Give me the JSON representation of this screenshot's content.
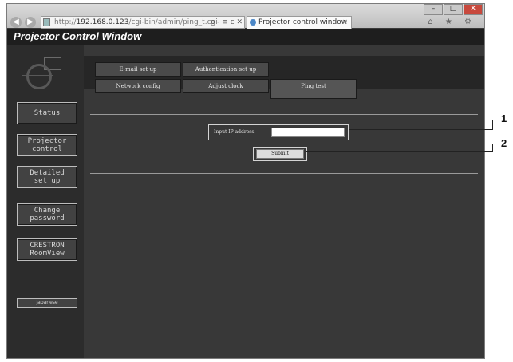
{
  "browser": {
    "address": "http://",
    "address_host": "192.168.0.123",
    "address_rest": "/cgi-bin/admin/ping_t.cgi",
    "address_controls": "ρ - ≡ c ✕",
    "tab_title": "Projector control window",
    "window_buttons": [
      "–",
      "□",
      "✕"
    ],
    "toolbar_icons": "⌂ ★ ⚙"
  },
  "app": {
    "title": "Projector Control Window"
  },
  "sidebar": {
    "items": [
      {
        "label": "Status"
      },
      {
        "label": "Projector\ncontrol"
      },
      {
        "label": "Detailed\nset up"
      },
      {
        "label": "Change\npassword"
      },
      {
        "label": "CRESTRON\nRoomView"
      }
    ],
    "language": "Japanese"
  },
  "tabs": {
    "row1": [
      "E-mail set up",
      "Authentication set up"
    ],
    "row2": [
      "Network config",
      "Adjust clock",
      "Ping test"
    ],
    "active": "Ping test"
  },
  "form": {
    "ip_label": "Input IP address",
    "ip_value": "",
    "submit_label": "Submit"
  },
  "callouts": [
    "1",
    "2"
  ]
}
